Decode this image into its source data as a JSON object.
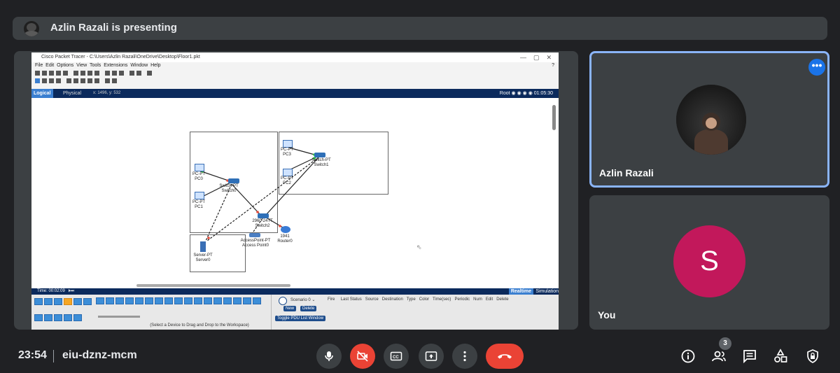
{
  "presenter": {
    "text": "Azlin Razali is presenting"
  },
  "shared_screen": {
    "window_title": "Cisco Packet Tracer - C:\\Users\\Azlin Razali\\OneDrive\\Desktop\\Floor1.pkt",
    "menu": [
      "File",
      "Edit",
      "Options",
      "View",
      "Tools",
      "Extensions",
      "Window",
      "Help"
    ],
    "tabs": {
      "logical": "Logical",
      "physical": "Physical",
      "coords": "x: 1496, y: 532"
    },
    "root_label": "Root",
    "clock": "01:05:30",
    "devices": [
      {
        "label": "PC-PT\nPC0"
      },
      {
        "label": "PC-PT\nPC1"
      },
      {
        "label": "Switch-PT\nSwitch0"
      },
      {
        "label": "PC-PT\nPC3"
      },
      {
        "label": "Switch-PT\nSwitch1"
      },
      {
        "label": "PC-PT\nPC2"
      },
      {
        "label": "2960-24TT\nSwitch2"
      },
      {
        "label": "1941\nRouter0"
      },
      {
        "label": "AccessPoint-PT\nAccess Point0"
      },
      {
        "label": "Server-PT\nServer0"
      }
    ],
    "time_label": "Time: 00:02:09",
    "realtime": "Realtime",
    "simulation": "Simulation",
    "scenario": "Scenario 0",
    "new_btn": "New",
    "delete_btn": "Delete",
    "toggle_btn": "Toggle PDU List Window",
    "pdu_columns": [
      "Fire",
      "Last Status",
      "Source",
      "Destination",
      "Type",
      "Color",
      "Time(sec)",
      "Periodic",
      "Num",
      "Edit",
      "Delete"
    ],
    "hint": "(Select a Device to Drag and Drop to the Workspace)"
  },
  "participants": [
    {
      "name": "Azlin Razali",
      "active_speaker": true
    },
    {
      "name": "You",
      "initial": "S",
      "avatar_color": "#c2185b"
    }
  ],
  "bottom_bar": {
    "time": "23:54",
    "meeting_code": "eiu-dznz-mcm",
    "controls": [
      "mic-icon",
      "camera-off-icon",
      "captions-icon",
      "present-icon",
      "more-vert-icon",
      "hang-up-icon"
    ],
    "right_icons": [
      "info-icon",
      "people-icon",
      "chat-icon",
      "activities-icon",
      "host-controls-icon"
    ],
    "people_count": "3"
  },
  "colors": {
    "accent": "#8ab4f8",
    "danger": "#ea4335",
    "bg": "#202124",
    "tile": "#3c4043"
  }
}
